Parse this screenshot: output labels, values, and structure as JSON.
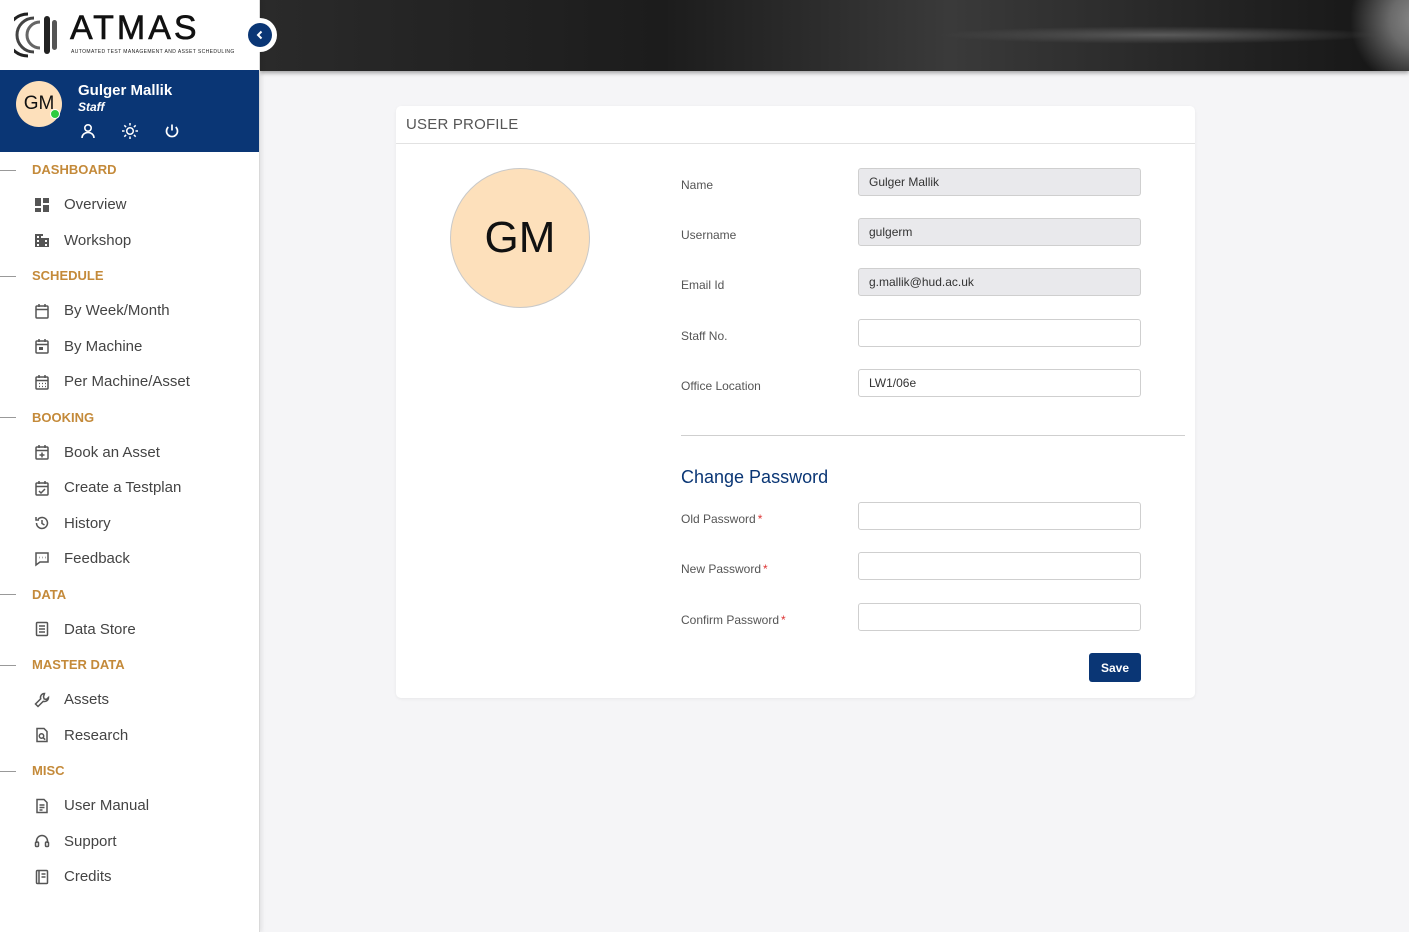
{
  "brand": {
    "name": "ATMAS",
    "tagline": "AUTOMATED TEST MANAGEMENT AND ASSET SCHEDULING"
  },
  "user": {
    "initials": "GM",
    "name": "Gulger Mallik",
    "role": "Staff",
    "status_color": "#2ecc40"
  },
  "colors": {
    "primary": "#0a3675",
    "section_heading": "#c48a3a",
    "avatar_bg": "#fde0bb"
  },
  "sidebar": {
    "sections": [
      {
        "title": "DASHBOARD",
        "items": [
          {
            "label": "Overview",
            "icon": "dashboard-icon"
          },
          {
            "label": "Workshop",
            "icon": "building-icon"
          }
        ]
      },
      {
        "title": "SCHEDULE",
        "items": [
          {
            "label": "By Week/Month",
            "icon": "calendar-icon"
          },
          {
            "label": "By Machine",
            "icon": "calendar-filled-icon"
          },
          {
            "label": "Per Machine/Asset",
            "icon": "calendar-grid-icon"
          }
        ]
      },
      {
        "title": "BOOKING",
        "items": [
          {
            "label": "Book an Asset",
            "icon": "calendar-plus-icon"
          },
          {
            "label": "Create a Testplan",
            "icon": "calendar-check-icon"
          },
          {
            "label": "History",
            "icon": "history-icon"
          },
          {
            "label": "Feedback",
            "icon": "feedback-icon"
          }
        ]
      },
      {
        "title": "DATA",
        "items": [
          {
            "label": "Data Store",
            "icon": "data-store-icon"
          }
        ]
      },
      {
        "title": "MASTER DATA",
        "items": [
          {
            "label": "Assets",
            "icon": "wrench-icon"
          },
          {
            "label": "Research",
            "icon": "document-search-icon"
          }
        ]
      },
      {
        "title": "MISC",
        "items": [
          {
            "label": "User Manual",
            "icon": "document-icon"
          },
          {
            "label": "Support",
            "icon": "headset-icon"
          },
          {
            "label": "Credits",
            "icon": "book-icon"
          }
        ]
      }
    ]
  },
  "profile": {
    "header": "USER PROFILE",
    "fields": [
      {
        "label": "Name",
        "value": "Gulger Mallik",
        "readonly": true
      },
      {
        "label": "Username",
        "value": "gulgerm",
        "readonly": true
      },
      {
        "label": "Email Id",
        "value": "g.mallik@hud.ac.uk",
        "readonly": true
      },
      {
        "label": "Staff No.",
        "value": "",
        "readonly": false
      },
      {
        "label": "Office Location",
        "value": "LW1/06e",
        "readonly": false
      }
    ],
    "change_password": {
      "title": "Change Password",
      "fields": [
        {
          "label": "Old Password",
          "required": "*"
        },
        {
          "label": "New Password",
          "required": "*"
        },
        {
          "label": "Confirm Password",
          "required": "*"
        }
      ],
      "save_label": "Save"
    }
  }
}
